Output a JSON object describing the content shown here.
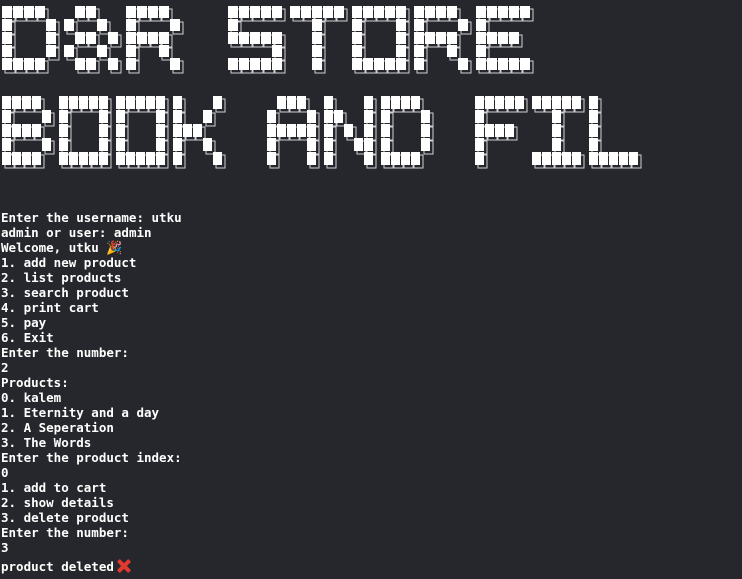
{
  "banner": {
    "line1": "D&R STORE",
    "line2": "BOOK AND FILM",
    "fill_color": "#ffffff",
    "shadow_color": "#cfd0d4"
  },
  "terminal": {
    "background": "#26272c",
    "text_color": "#ffffff",
    "username_prompt": "Enter the username: ",
    "username_value": "utku",
    "role_prompt": "admin or user: ",
    "role_value": "admin",
    "welcome": "Welcome, utku ",
    "welcome_icon": "party-popper-icon",
    "menu": [
      "1. add new product",
      "2. list products",
      "3. search product",
      "4. print cart",
      "5. pay",
      "6. Exit"
    ],
    "number_prompt_1": "Enter the number:",
    "number_input_1": "2",
    "products_heading": "Products:",
    "products": [
      "0. kalem",
      "1. Eternity and a day",
      "2. A Seperation",
      "3. The Words"
    ],
    "index_prompt": "Enter the product index:",
    "index_input": "0",
    "product_menu": [
      "1. add to cart",
      "2. show details",
      "3. delete product"
    ],
    "number_prompt_2": "Enter the number:",
    "number_input_2": "3",
    "result": "product deleted",
    "result_icon": "cross-mark-icon"
  }
}
